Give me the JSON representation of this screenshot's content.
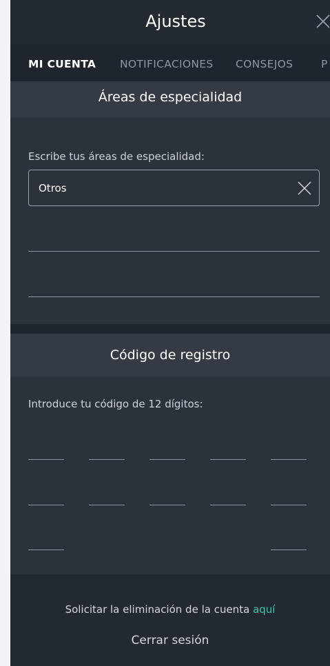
{
  "header": {
    "title": "Ajustes",
    "close_icon": "close-icon"
  },
  "tabs": [
    {
      "label": "MI CUENTA",
      "active": true
    },
    {
      "label": "NOTIFICACIONES",
      "active": false
    },
    {
      "label": "CONSEJOS",
      "active": false
    },
    {
      "label": "P",
      "active": false
    }
  ],
  "specialty": {
    "section_title": "Áreas de especialidad",
    "prompt": "Escribe tus áreas de especialidad:",
    "inputs": [
      "Otros",
      "",
      ""
    ],
    "clear_icon": "close-icon"
  },
  "registration": {
    "section_title": "Código de registro",
    "prompt": "Introduce tu código de 12 dígitos:",
    "digits": [
      "",
      "",
      "",
      "",
      "",
      "",
      "",
      "",
      "",
      "",
      "",
      ""
    ]
  },
  "footer": {
    "delete_text": "Solicitar la eliminación de la cuenta ",
    "delete_link": "aquí",
    "logout": "Cerrar sesión"
  },
  "colors": {
    "background": "#2b323a",
    "accent": "#3fc4b2",
    "active_tab": "#ffffff"
  }
}
